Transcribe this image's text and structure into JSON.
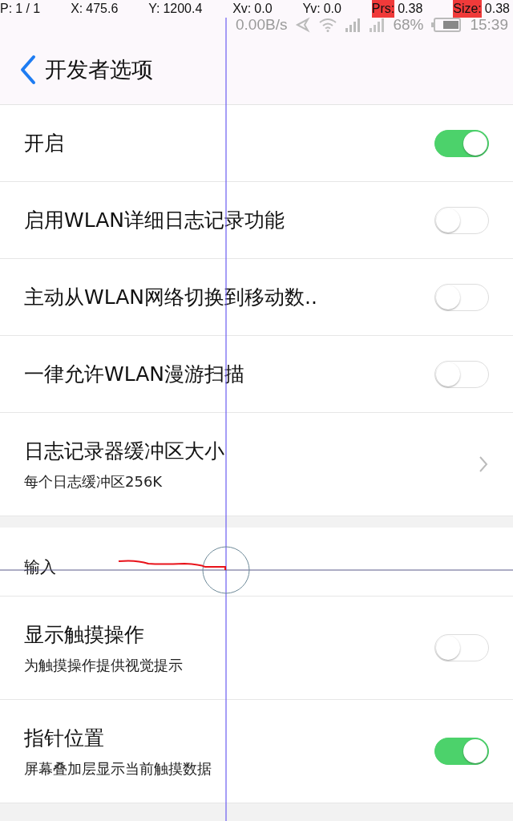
{
  "pointer_info": [
    {
      "label": "P:",
      "value": "1 / 1",
      "highlighted": false
    },
    {
      "label": "X:",
      "value": "475.6",
      "highlighted": false
    },
    {
      "label": "Y:",
      "value": "1200.4",
      "highlighted": false
    },
    {
      "label": "Xv:",
      "value": "0.0",
      "highlighted": false
    },
    {
      "label": "Yv:",
      "value": "0.0",
      "highlighted": false
    },
    {
      "label": "Prs:",
      "value": "0.38",
      "highlighted": true
    },
    {
      "label": "Size:",
      "value": "0.38",
      "highlighted": true
    }
  ],
  "status_bar": {
    "speed": "0.00B/s",
    "battery": "68%",
    "time": "15:39"
  },
  "header": {
    "title": "开发者选项"
  },
  "sections": [
    {
      "rows": [
        {
          "kind": "toggle",
          "title": "开启",
          "on": true
        },
        {
          "kind": "toggle",
          "title": "启用WLAN详细日志记录功能",
          "on": false
        },
        {
          "kind": "toggle",
          "title": "主动从WLAN网络切换到移动数..",
          "on": false
        },
        {
          "kind": "toggle",
          "title": "一律允许WLAN漫游扫描",
          "on": false
        },
        {
          "kind": "link",
          "title": "日志记录器缓冲区大小",
          "subtitle": "每个日志缓冲区256K"
        }
      ]
    },
    {
      "title": "输入",
      "rows": [
        {
          "kind": "toggle",
          "title": "显示触摸操作",
          "subtitle": "为触摸操作提供视觉提示",
          "on": false
        },
        {
          "kind": "toggle",
          "title": "指针位置",
          "subtitle": "屏幕叠加层显示当前触摸数据",
          "on": true
        }
      ]
    }
  ]
}
